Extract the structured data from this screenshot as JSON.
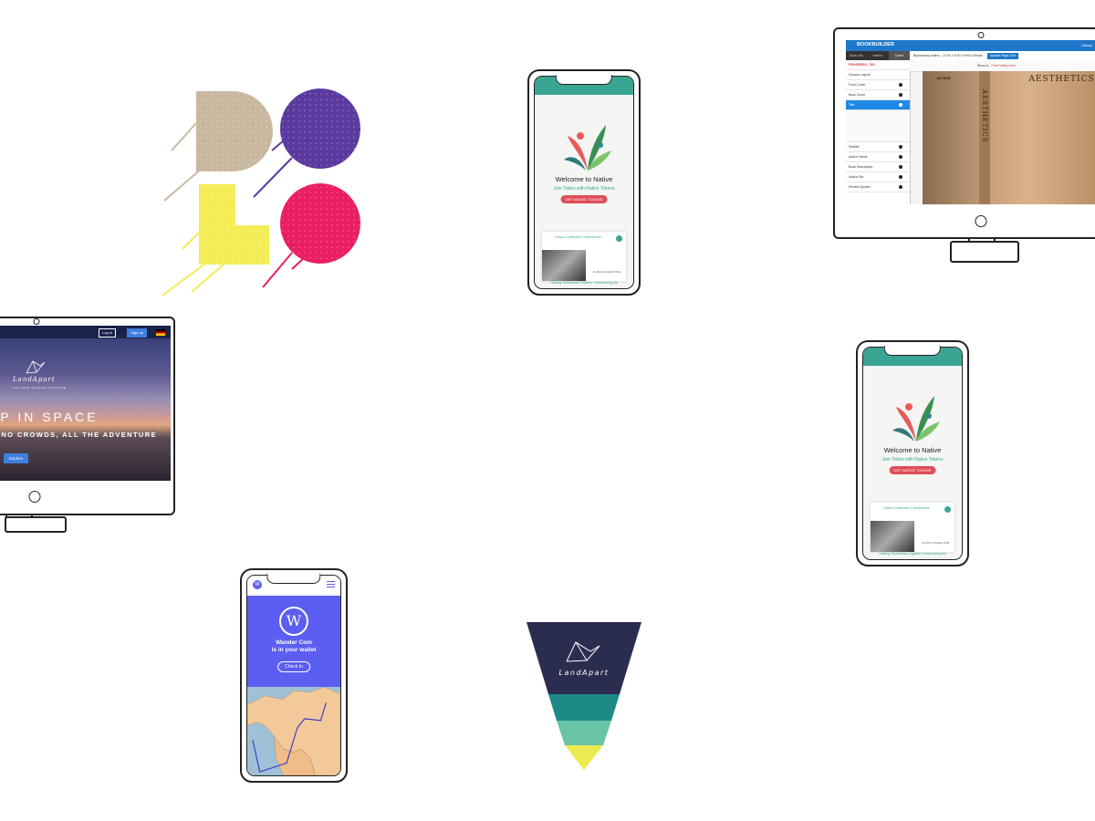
{
  "colors": {
    "dolo_tan": "#c9b8a0",
    "dolo_purple": "#5a3a9e",
    "dolo_yellow": "#f3ec55",
    "dolo_pink": "#e91e63",
    "native_teal": "#3aa592",
    "native_red": "#e04e58",
    "wander_blue": "#5b5ef0",
    "triangle_navy": "#2a2d4f",
    "triangle_teal": "#1e8a87",
    "triangle_mint": "#69c4a7",
    "triangle_yellow": "#ecea50",
    "bookbuilder_blue": "#1e77c9"
  },
  "landapart_site": {
    "login": "Log in",
    "signup": "Sign up",
    "brand": "LandApart",
    "tagline": "THE LAND SHARING PLATFORM",
    "headline": "AP IN SPACE",
    "subheadline": "S, NO CROWDS, ALL THE ADVENTURE",
    "explore_button": "Explore"
  },
  "bookbuilder": {
    "logo": "BOOKBUILDER",
    "library": "Library",
    "tabs": [
      "Book Info",
      "Interior",
      "Cover"
    ],
    "book_title": "Bloomsbury Antho...",
    "trim": "6.00 x 9.00",
    "format": "Print & Ebook",
    "update_button": "Update Page Grid",
    "progress": "PROGRESS: 78%",
    "sidebar_items": [
      "Choose Layout",
      "Front Cover",
      "Back Cover",
      "Title",
      "Subtitle",
      "Author Name",
      "Book Description",
      "Author Bio",
      "Review Quotes"
    ],
    "active_item": "Title",
    "show_in": "Show in",
    "print_safety": "Print Safety Area",
    "cover_title": "AESTHETICS",
    "spine_title": "AESTHETICS",
    "back_title": "AUTHOR"
  },
  "native_app": {
    "welcome": "Welcome to Native",
    "subtitle": "Join Tribes with Native Tokens",
    "button": "GET NATIVE TOKENS",
    "card_title": "Cloud Collective Conference",
    "card_logo": "CLOUD COLLECTIVE",
    "footer": "Hosting Tradeshows Together. Harmonizing the"
  },
  "wander_app": {
    "logo_letter": "W",
    "title_line1": "Wander Coin",
    "title_line2": "is in your wallet",
    "button": "Check In"
  },
  "triangle_logo": {
    "brand": "LandApart"
  }
}
